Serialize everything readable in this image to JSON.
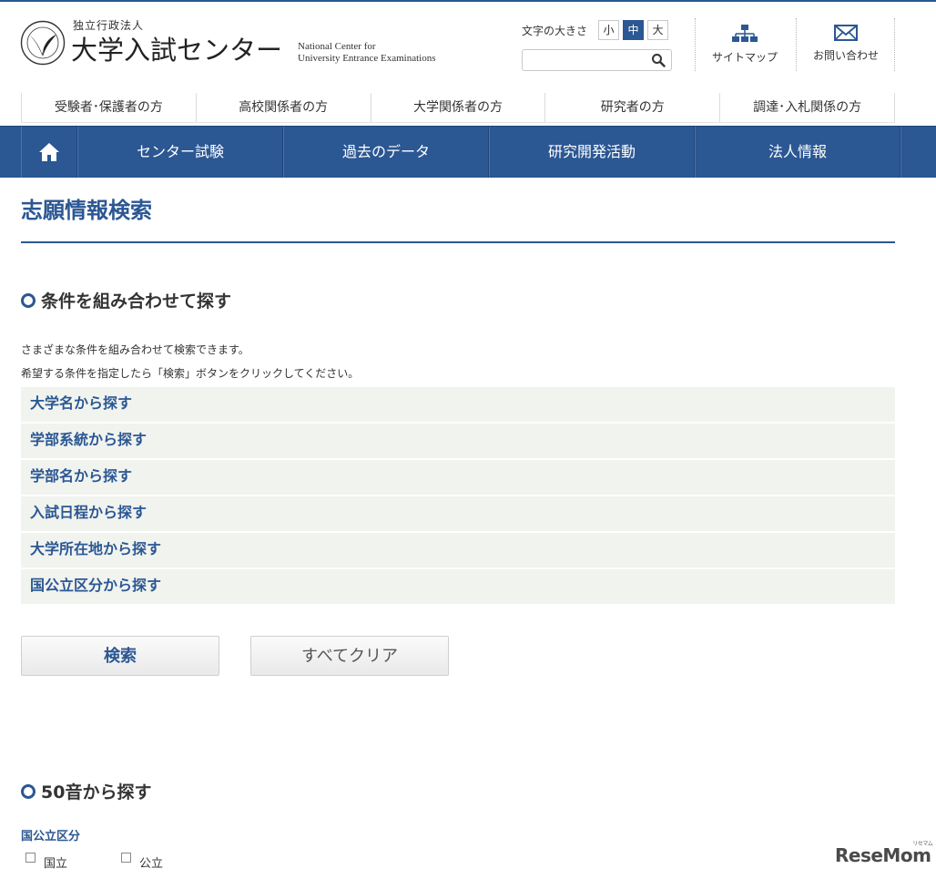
{
  "header": {
    "org_small": "独立行政法人",
    "org_name": "大学入試センター",
    "org_en_line1": "National Center for",
    "org_en_line2": "University Entrance Examinations",
    "font_size_label": "文字の大きさ",
    "font_sizes": [
      "小",
      "中",
      "大"
    ],
    "font_size_selected": "中",
    "search_value": "",
    "sitemap_label": "サイトマップ",
    "contact_label": "お問い合わせ"
  },
  "audience_nav": [
    "受験者･保護者の方",
    "高校関係者の方",
    "大学関係者の方",
    "研究者の方",
    "調達･入札関係の方"
  ],
  "main_nav": [
    "センター試験",
    "過去のデータ",
    "研究開発活動",
    "法人情報"
  ],
  "page_title": "志願情報検索",
  "section1": {
    "heading": "条件を組み合わせて探す",
    "desc1": "さまざまな条件を組み合わせて検索できます。",
    "desc2": "希望する条件を指定したら「検索」ボタンをクリックしてください。",
    "conditions": [
      "大学名から探す",
      "学部系統から探す",
      "学部名から探す",
      "入試日程から探す",
      "大学所在地から探す",
      "国公立区分から探す"
    ],
    "search_button": "検索",
    "clear_button": "すべてクリア"
  },
  "section2": {
    "heading": "50音から探す",
    "group_label": "国公立区分",
    "options": [
      {
        "label": "国立",
        "checked": false
      },
      {
        "label": "公立",
        "checked": false
      }
    ]
  },
  "watermark": {
    "text": "ReseMom",
    "small": "リセマム"
  },
  "colors": {
    "brand": "#2b5793",
    "row_bg": "#f1f3ef"
  }
}
